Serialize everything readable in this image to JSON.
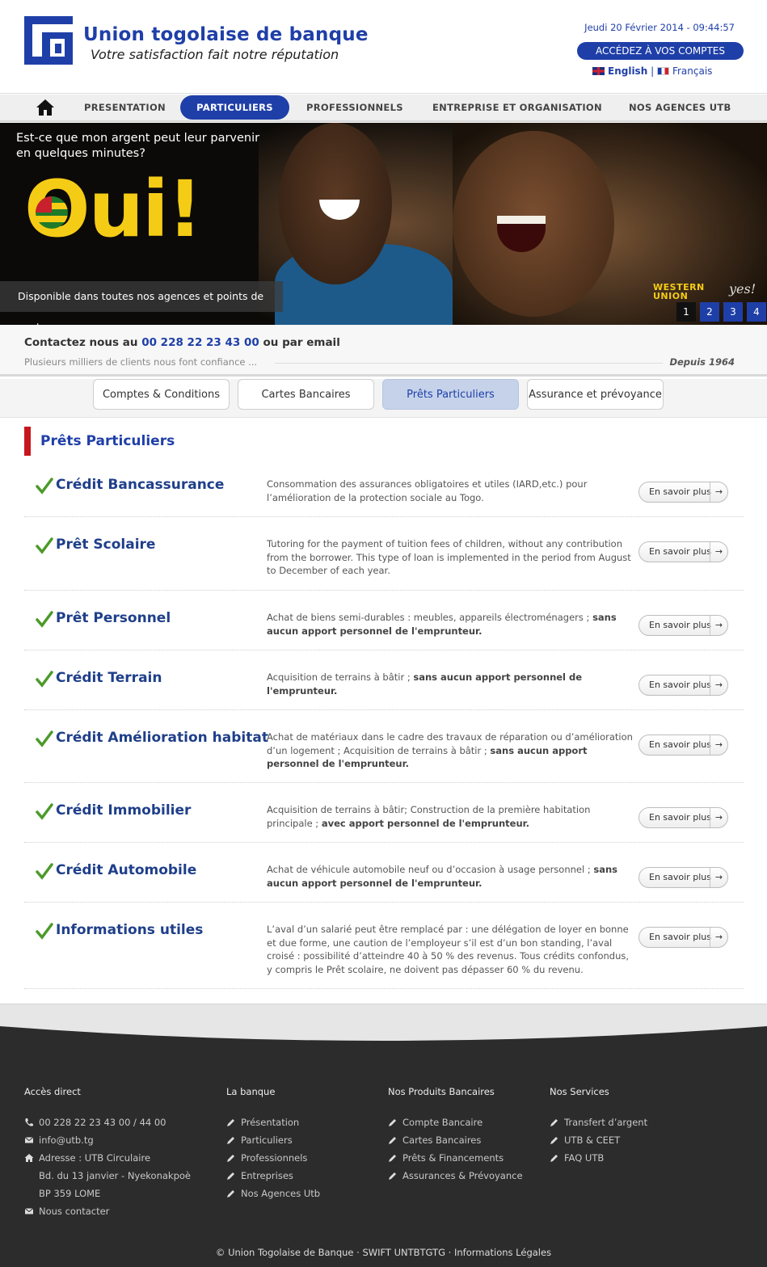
{
  "header": {
    "brand_name": "Union togolaise de banque",
    "brand_tagline": "Votre satisfaction fait notre réputation",
    "datetime": "Jeudi 20 Février 2014 - 09:44:57",
    "access_button": "ACCÉDEZ À VOS COMPTES",
    "lang_english": "English",
    "lang_separator": "|",
    "lang_french": "Français",
    "accent_color": "#1f3fa8"
  },
  "nav": {
    "home_icon": "home-icon",
    "items": [
      "PRESENTATION",
      "PARTICULIERS",
      "PROFESSIONNELS",
      "ENTREPRISE ET ORGANISATION",
      "NOS AGENCES UTB"
    ],
    "active": "PARTICULIERS"
  },
  "banner": {
    "question": "Est-ce que mon argent peut leur parvenir en quelques minutes?",
    "oui": "Oui!",
    "availability": "Disponible dans toutes nos agences et points de vente",
    "wu_line1": "WESTERN",
    "wu_line2": "UNION",
    "wu_yes": "yes!",
    "slides": [
      "1",
      "2",
      "3",
      "4"
    ],
    "active_slide": "1"
  },
  "contact": {
    "prefix": "Contactez nous au ",
    "phone": "00 228 22 23 43 00",
    "suffix": " ou par email",
    "subtitle": "Plusieurs milliers de clients nous font confiance ...",
    "since": "Depuis 1964"
  },
  "tabs": [
    "Comptes & Conditions",
    "Cartes Bancaires",
    "Prêts Particuliers",
    "Assurance et prévoyance"
  ],
  "active_tab": "Prêts Particuliers",
  "section_title": "Prêts Particuliers",
  "more_label": "En savoir plus",
  "more_arrow": "→",
  "items": [
    {
      "title": "Crédit Bancassurance",
      "desc": "Consommation des assurances obligatoires et utiles (IARD,etc.) pour l’amélioration de la protection sociale au Togo.",
      "bold": ""
    },
    {
      "title": "Prêt Scolaire",
      "desc": "Tutoring for the payment of tuition fees of children, without any contribution from the borrower. This type of loan is implemented in the period from August to December of each year.",
      "bold": ""
    },
    {
      "title": "Prêt Personnel",
      "desc": "Achat de biens semi-durables : meubles, appareils électroménagers ; ",
      "bold": "sans aucun apport personnel de l'emprunteur."
    },
    {
      "title": "Crédit Terrain",
      "desc": "Acquisition de terrains à bâtir ; ",
      "bold": "sans aucun apport personnel de l'emprunteur."
    },
    {
      "title": "Crédit Amélioration habitat",
      "desc": "Achat de matériaux dans le cadre des travaux de réparation ou d’amélioration d’un logement ; Acquisition de terrains à bâtir ; ",
      "bold": "sans aucun apport personnel de l'emprunteur."
    },
    {
      "title": "Crédit Immobilier",
      "desc": "Acquisition de terrains à bâtir; Construction de la première habitation principale ; ",
      "bold": "avec apport personnel de l'emprunteur."
    },
    {
      "title": "Crédit Automobile",
      "desc": "Achat de véhicule automobile neuf ou d’occasion à usage personnel ; ",
      "bold": "sans aucun apport personnel de l'emprunteur."
    },
    {
      "title": "Informations utiles",
      "desc": "L’aval d’un salarié peut être remplacé par : une délégation de loyer en bonne et due forme, une caution de l’employeur s’il est d’un bon standing, l’aval croisé : possibilité d’atteindre 40 à 50 % des revenus. Tous crédits confondus, y compris le Prêt scolaire, ne doivent pas dépasser 60 % du revenu.",
      "bold": ""
    }
  ],
  "footer": {
    "col1": {
      "title": "Accès direct",
      "phone": "00 228 22 23 43 00 / 44 00",
      "email": "info@utb.tg",
      "address1": "Adresse : UTB Circulaire",
      "address2": "Bd. du 13 janvier - Nyekonakpoè",
      "address3": "BP 359 LOME",
      "contact": "Nous contacter"
    },
    "col2": {
      "title": "La banque",
      "links": [
        "Présentation",
        "Particuliers",
        "Professionnels",
        "Entreprises",
        "Nos Agences Utb"
      ]
    },
    "col3": {
      "title": "Nos Produits Bancaires",
      "links": [
        "Compte Bancaire",
        "Cartes Bancaires",
        "Prêts & Financements",
        "Assurances & Prévoyance"
      ]
    },
    "col4": {
      "title": "Nos Services",
      "links": [
        "Transfert d’argent",
        "UTB & CEET",
        "FAQ UTB"
      ]
    },
    "copyright": "© Union Togolaise de Banque · SWIFT UNTBTGTG · Informations Légales"
  }
}
